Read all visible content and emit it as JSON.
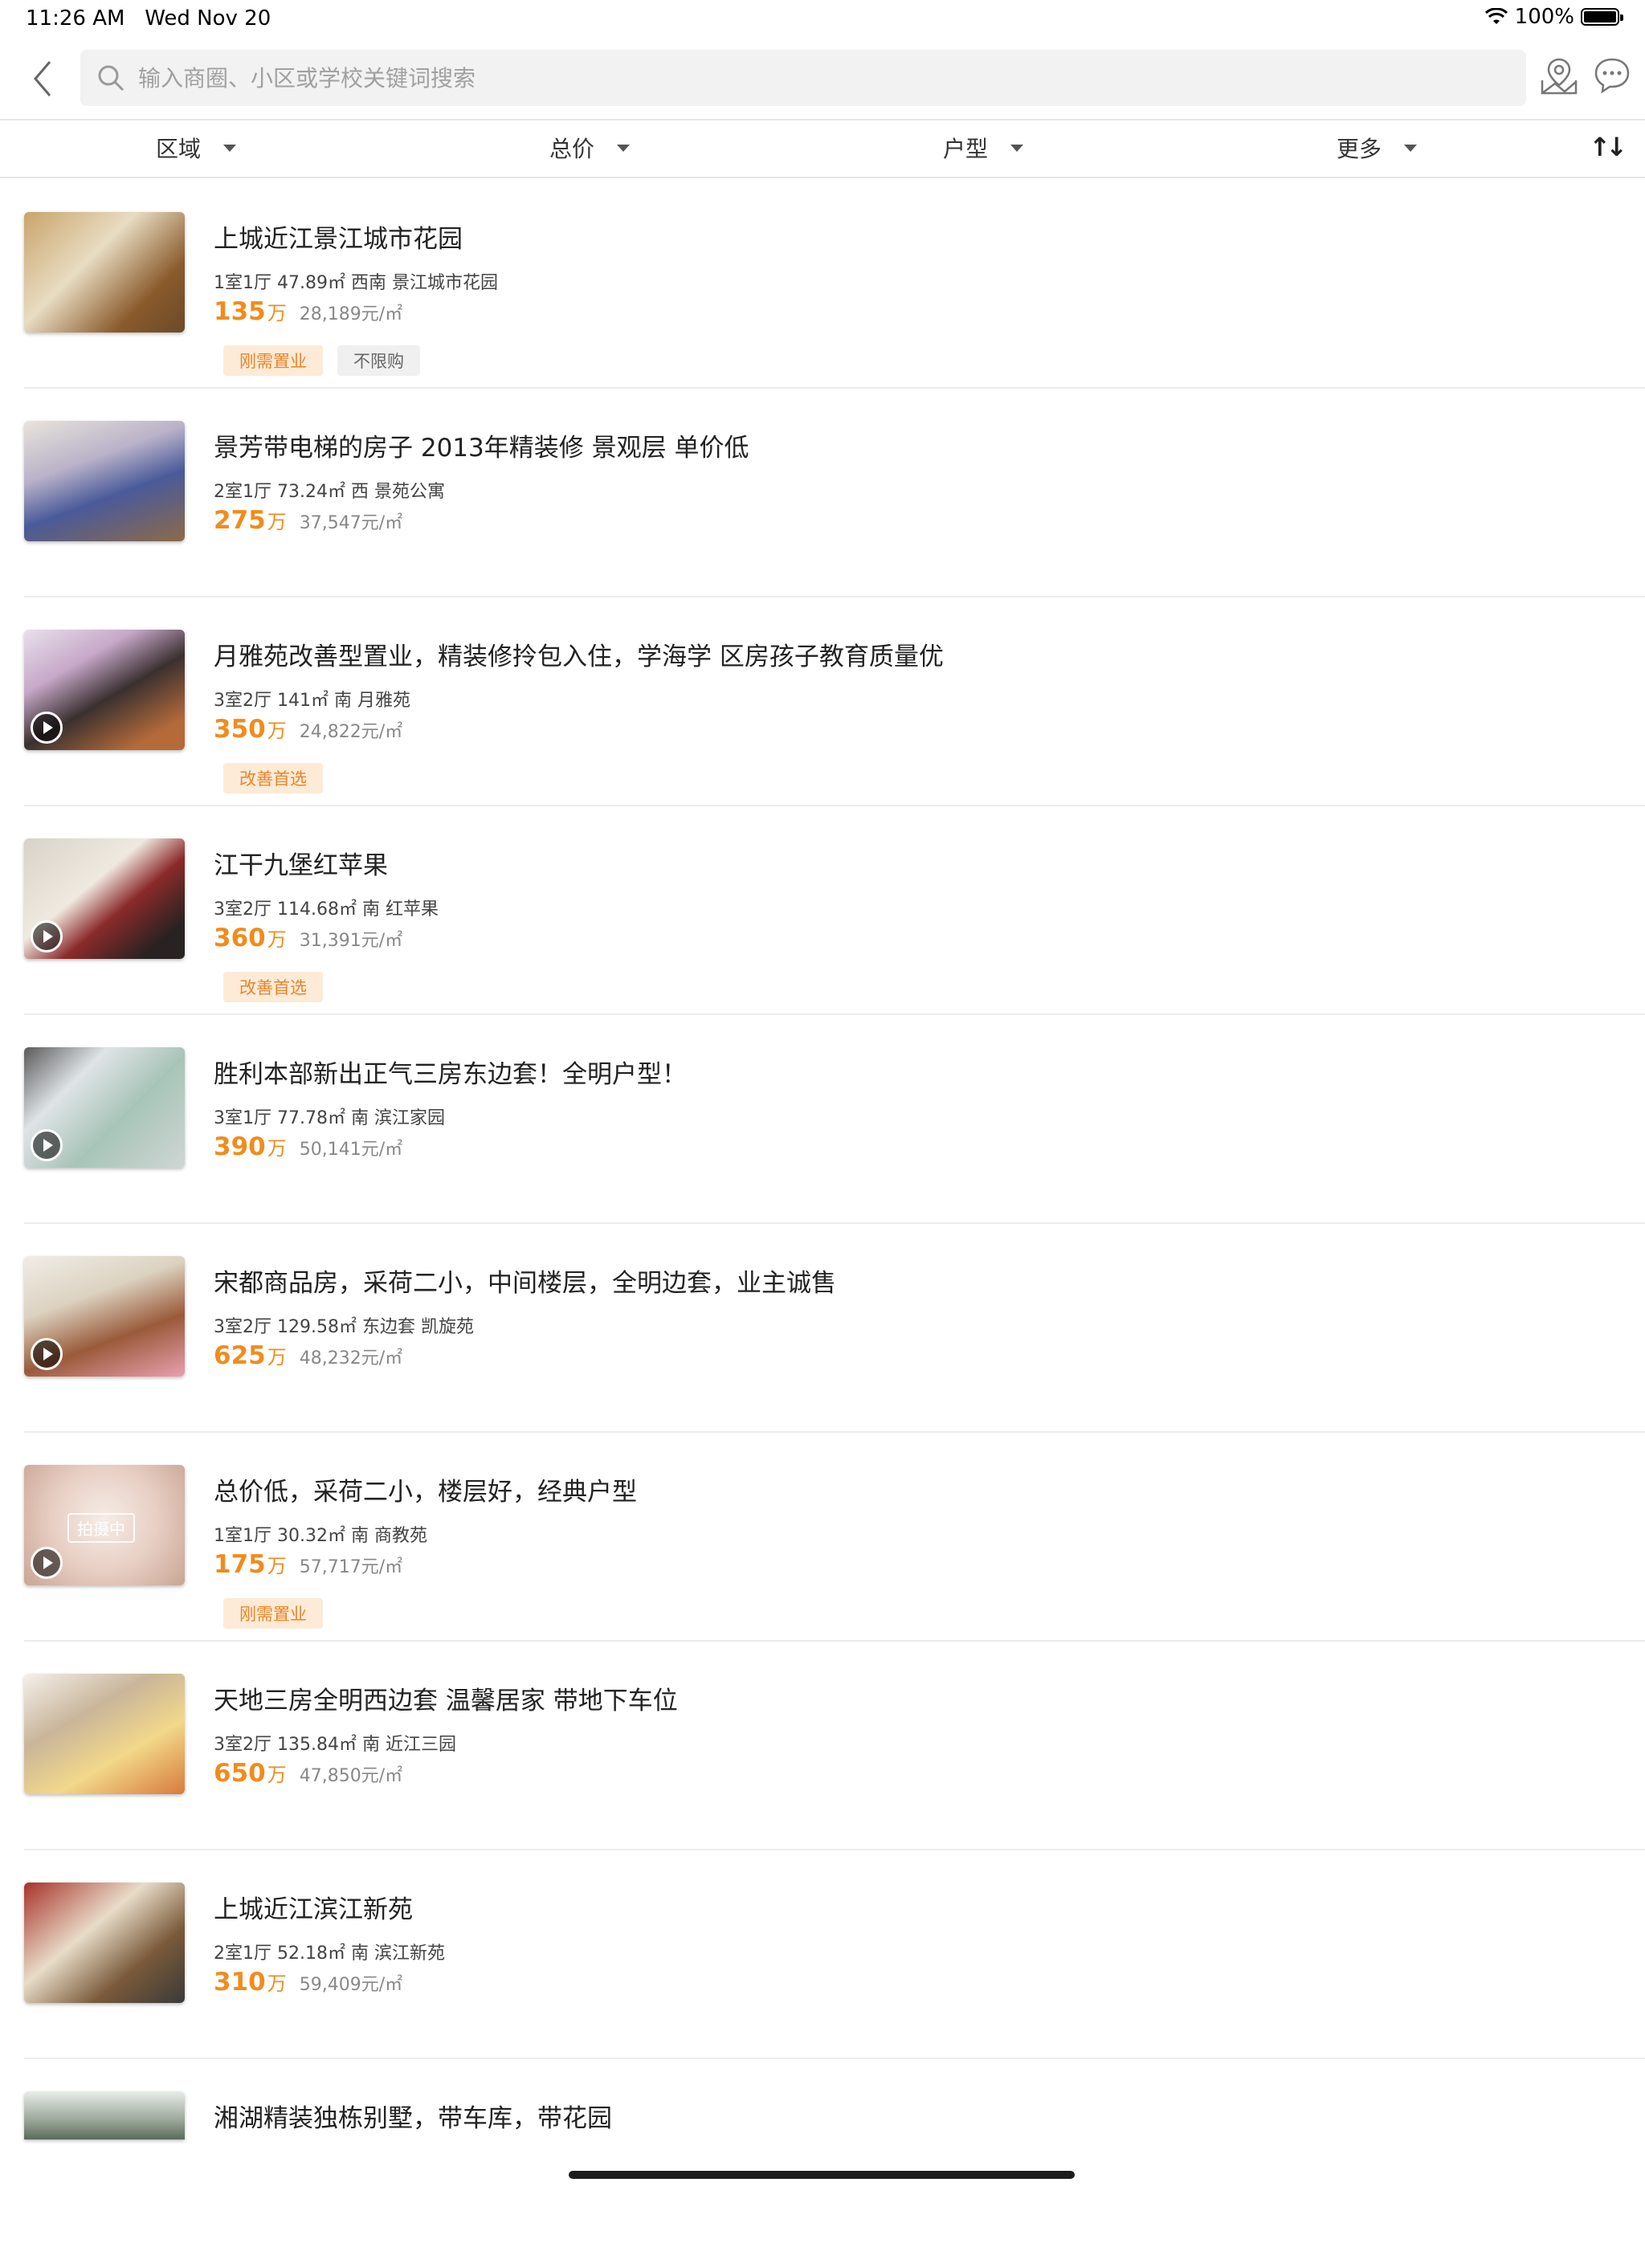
{
  "status_bar": {
    "time": "11:26 AM",
    "date": "Wed Nov 20",
    "battery": "100%"
  },
  "search": {
    "placeholder": "输入商圈、小区或学校关键词搜索"
  },
  "filters": [
    {
      "label": "区域"
    },
    {
      "label": "总价"
    },
    {
      "label": "户型"
    },
    {
      "label": "更多"
    }
  ],
  "sort_label": "↑↓",
  "listings": [
    {
      "title": "上城近江景江城市花园",
      "meta": "1室1厅 47.89㎡ 西南 景江城市花园",
      "price": "135",
      "unit": "万",
      "per_sqm": "28,189元/㎡",
      "tags": [
        "刚需置业",
        "不限购"
      ],
      "has_video": false
    },
    {
      "title": "景芳带电梯的房子 2013年精装修 景观层 单价低",
      "meta": "2室1厅 73.24㎡ 西 景苑公寓",
      "price": "275",
      "unit": "万",
      "per_sqm": "37,547元/㎡",
      "tags": [],
      "has_video": false
    },
    {
      "title": "月雅苑改善型置业，精装修拎包入住，学海学 区房孩子教育质量优",
      "meta": "3室2厅 141㎡ 南 月雅苑",
      "price": "350",
      "unit": "万",
      "per_sqm": "24,822元/㎡",
      "tags": [
        "改善首选"
      ],
      "has_video": true
    },
    {
      "title": "江干九堡红苹果",
      "meta": "3室2厅 114.68㎡ 南 红苹果",
      "price": "360",
      "unit": "万",
      "per_sqm": "31,391元/㎡",
      "tags": [
        "改善首选"
      ],
      "has_video": true
    },
    {
      "title": "胜利本部新出正气三房东边套！全明户型！",
      "meta": "3室1厅 77.78㎡ 南 滨江家园",
      "price": "390",
      "unit": "万",
      "per_sqm": "50,141元/㎡",
      "tags": [],
      "has_video": true
    },
    {
      "title": "宋都商品房，采荷二小，中间楼层，全明边套，业主诚售",
      "meta": "3室2厅 129.58㎡ 东边套 凯旋苑",
      "price": "625",
      "unit": "万",
      "per_sqm": "48,232元/㎡",
      "tags": [],
      "has_video": true
    },
    {
      "title": "总价低，采荷二小，楼层好，经典户型",
      "meta": "1室1厅 30.32㎡ 南 商教苑",
      "price": "175",
      "unit": "万",
      "per_sqm": "57,717元/㎡",
      "tags": [
        "刚需置业"
      ],
      "has_video": true,
      "thumb_text": "拍摄中"
    },
    {
      "title": "天地三房全明西边套 温馨居家 带地下车位",
      "meta": "3室2厅 135.84㎡ 南 近江三园",
      "price": "650",
      "unit": "万",
      "per_sqm": "47,850元/㎡",
      "tags": [],
      "has_video": false
    },
    {
      "title": "上城近江滨江新苑",
      "meta": "2室1厅 52.18㎡ 南 滨江新苑",
      "price": "310",
      "unit": "万",
      "per_sqm": "59,409元/㎡",
      "tags": [],
      "has_video": false
    },
    {
      "title": "湘湖精装独栋别墅，带车库，带花园",
      "meta": "",
      "price": "",
      "unit": "",
      "per_sqm": "",
      "tags": [],
      "has_video": false
    }
  ],
  "colors": {
    "accent": "#f08c1d",
    "tag_bg": "#fdebd7",
    "divider": "#ececec"
  }
}
